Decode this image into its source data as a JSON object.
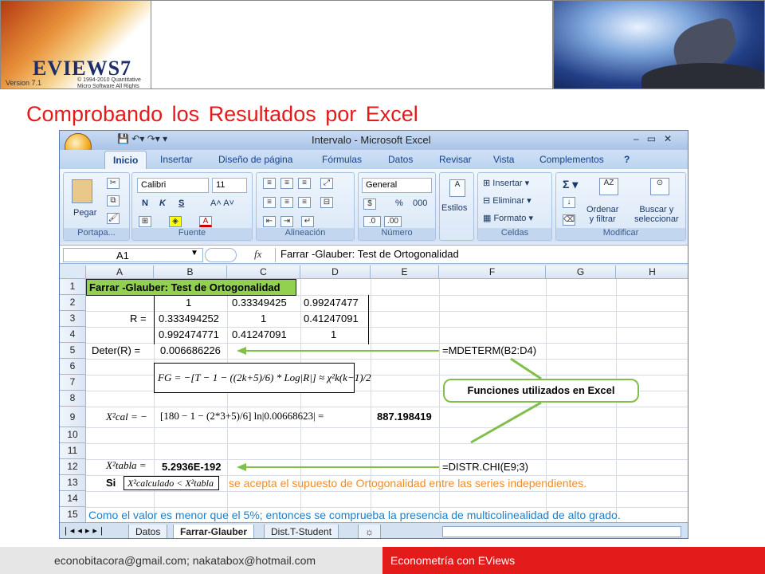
{
  "header": {
    "logo_text": "EVIEWS7",
    "logo_version": "Version 7.1",
    "logo_copyright": "© 1994-2010 Quantitative Micro Software\nAll Rights Reserved",
    "slide_title": "Comprobando los Resultados por Excel"
  },
  "excel": {
    "window_title": "Intervalo - Microsoft Excel",
    "tabs": [
      "Inicio",
      "Insertar",
      "Diseño de página",
      "Fórmulas",
      "Datos",
      "Revisar",
      "Vista",
      "Complementos"
    ],
    "ribbon": {
      "portapapeles": {
        "label": "Portapa...",
        "pegar": "Pegar"
      },
      "fuente": {
        "label": "Fuente",
        "font": "Calibri",
        "size": "11",
        "bold": "N",
        "italic": "K",
        "underline": "S"
      },
      "alineacion": {
        "label": "Alineación"
      },
      "numero": {
        "label": "Número",
        "format": "General",
        "percent": "%",
        "thousands": "000"
      },
      "estilos": {
        "label": "Estilos"
      },
      "celdas": {
        "label": "Celdas",
        "insertar": "Insertar",
        "eliminar": "Eliminar",
        "formato": "Formato"
      },
      "modificar": {
        "label": "Modificar",
        "ordenar": "Ordenar\ny filtrar",
        "buscar": "Buscar y\nseleccionar"
      }
    },
    "formula_bar": {
      "name_box": "A1",
      "formula": "Farrar -Glauber: Test de Ortogonalidad"
    },
    "columns": [
      "A",
      "B",
      "C",
      "D",
      "E",
      "F",
      "G",
      "H"
    ],
    "rows": [
      "1",
      "2",
      "3",
      "4",
      "5",
      "6",
      "7",
      "8",
      "9",
      "10",
      "11",
      "12",
      "13",
      "14",
      "15"
    ],
    "cells": {
      "a1": "Farrar -Glauber: Test de Ortogonalidad",
      "b2": "1",
      "c2": "0.33349425",
      "d2": "0.99247477",
      "a3": "R =",
      "b3": "0.333494252",
      "c3": "1",
      "d3": "0.41247091",
      "b4": "0.992474771",
      "c4": "0.41247091",
      "d4": "1",
      "a5": "Deter(R) =",
      "b5": "0.006686226",
      "f5": "=MDETERM(B2:D4)",
      "eq_fg": "FG = −[T − 1 − ((2k+5)/6) * Log|R|] ≈ χ²k(k−1)/2",
      "eq_chi_left": "X²cal = −",
      "eq_chi_mid": "[180 − 1 − (2*3+5)/6] ln|0.00668623| =",
      "e9": "887.198419",
      "a11": "X²tabla =",
      "b11": "5.2936E-192",
      "f11": "=DISTR.CHI(E9;3)",
      "a13_si": "Si",
      "a13_eq": "X²calculado < X²tabla",
      "row13": "se acepta el supuesto de Ortogonalidad entre las series independientes.",
      "row15": "Como el valor es menor que el 5%; entonces se comprueba la presencia de multicolinealidad de alto grado."
    },
    "callout": "Funciones utilizados en Excel",
    "sheet_tabs": [
      "Datos",
      "Farrar-Glauber",
      "Dist.T-Student"
    ],
    "active_sheet": "Farrar-Glauber"
  },
  "footer": {
    "contact": "econobitacora@gmail.com;  nakatabox@hotmail.com",
    "course": "Econometría con EViews"
  },
  "colors": {
    "title_red": "#e31b1b",
    "a1_fill": "#92d050",
    "orange_text": "#f28c28",
    "blue_text": "#1e7fc8",
    "arrow_green": "#7fbf4a"
  }
}
